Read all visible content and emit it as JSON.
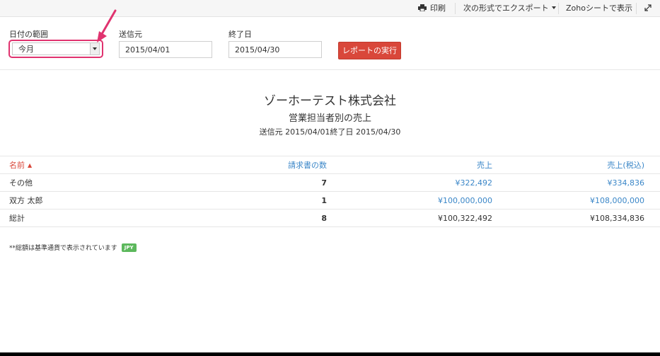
{
  "toolbar": {
    "print_label": "印刷",
    "export_label": "次の形式でエクスポート",
    "zoho_sheet_label": "Zohoシートで表示",
    "expand_icon": "expand-icon",
    "print_icon": "printer-icon"
  },
  "filters": {
    "date_range_label": "日付の範囲",
    "date_range_value": "今月",
    "from_label": "送信元",
    "from_value": "2015/04/01",
    "to_label": "終了日",
    "to_value": "2015/04/30",
    "run_button": "レポートの実行"
  },
  "report": {
    "company": "ゾーホーテスト株式会社",
    "title": "営業担当者別の売上",
    "range_text": "送信元 2015/04/01終了日 2015/04/30"
  },
  "table": {
    "headers": {
      "name": "名前",
      "count": "請求書の数",
      "sales": "売上",
      "sales_tax": "売上(税込)"
    },
    "rows": [
      {
        "name": "その他",
        "count": "7",
        "sales": "¥322,492",
        "sales_tax": "¥334,836"
      },
      {
        "name": "双方 太郎",
        "count": "1",
        "sales": "¥100,000,000",
        "sales_tax": "¥108,000,000"
      }
    ],
    "total": {
      "name": "総計",
      "count": "8",
      "sales": "¥100,322,492",
      "sales_tax": "¥108,334,836"
    }
  },
  "footnote": {
    "text": "**総額は基準通貨で表示されています",
    "currency_badge": "JPY"
  },
  "colors": {
    "accent_red": "#d9473a",
    "link_blue": "#3b87c8",
    "highlight_pink": "#e0336f",
    "badge_green": "#5cb85c"
  }
}
